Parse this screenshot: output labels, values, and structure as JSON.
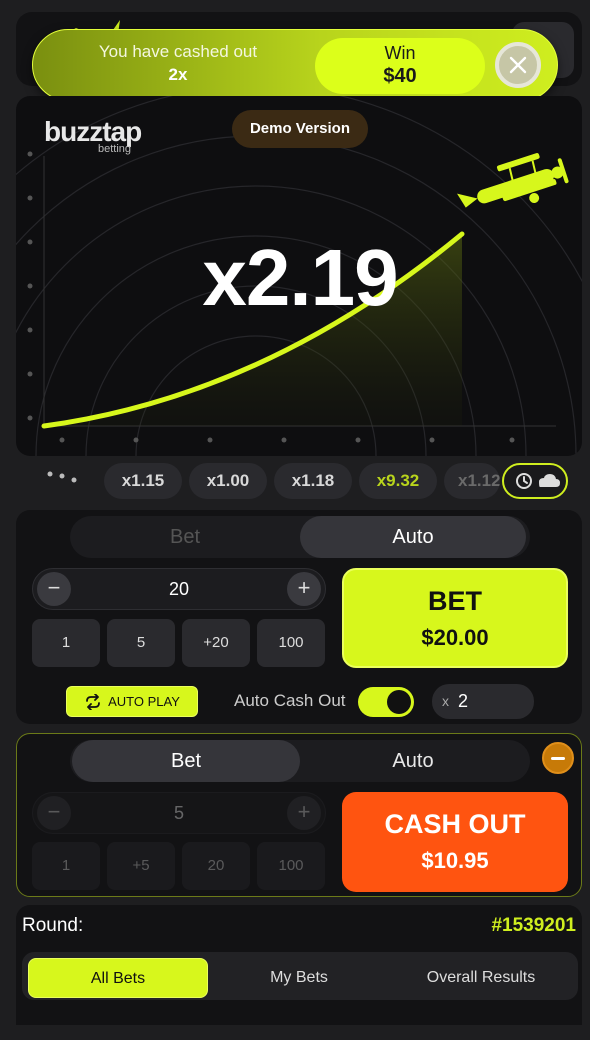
{
  "toast": {
    "message": "You have cashed out",
    "multiplier": "2x",
    "win_label": "Win",
    "win_amount": "$40"
  },
  "game": {
    "brand_name": "buzztap",
    "brand_sub": "betting",
    "demo_label": "Demo Version",
    "multiplier": "x2.19"
  },
  "history": {
    "chips": [
      {
        "value": "x1.15"
      },
      {
        "value": "x1.00"
      },
      {
        "value": "x1.18"
      },
      {
        "value": "x9.32"
      },
      {
        "value": "x1.12"
      }
    ]
  },
  "bet1": {
    "tabs": [
      "Bet",
      "Auto"
    ],
    "active_tab": "Auto",
    "amount": "20",
    "quick": [
      "1",
      "5",
      "+20",
      "100"
    ],
    "button_title": "BET",
    "button_amount": "$20.00",
    "autoplay_label": "AUTO PLAY",
    "auto_cash_label": "Auto Cash Out",
    "auto_cash_enabled": true,
    "cash_at_prefix": "x",
    "cash_at_value": "2"
  },
  "bet2": {
    "tabs": [
      "Bet",
      "Auto"
    ],
    "active_tab": "Bet",
    "amount": "5",
    "quick": [
      "1",
      "+5",
      "20",
      "100"
    ],
    "button_title": "CASH OUT",
    "button_amount": "$10.95"
  },
  "round": {
    "label": "Round:",
    "id": "#1539201",
    "tabs": [
      "All Bets",
      "My Bets",
      "Overall Results"
    ],
    "active_tab": "All Bets"
  },
  "colors": {
    "accent": "#d7f71c",
    "cashout": "#ff5410",
    "background": "#1e1e20"
  }
}
